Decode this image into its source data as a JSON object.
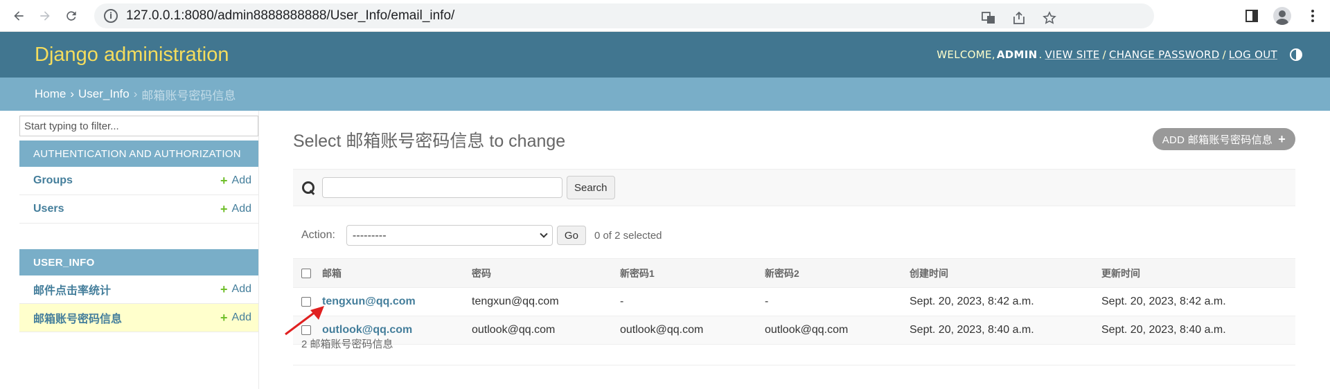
{
  "browser": {
    "url": "127.0.0.1:8080/admin8888888888/User_Info/email_info/"
  },
  "header": {
    "branding": "Django administration",
    "welcome": "WELCOME,",
    "user": "ADMIN",
    "view_site": "VIEW SITE",
    "change_password": "CHANGE PASSWORD",
    "log_out": "LOG OUT"
  },
  "breadcrumbs": {
    "home": "Home",
    "app": "User_Info",
    "current": "邮箱账号密码信息"
  },
  "sidebar": {
    "filter_placeholder": "Start typing to filter...",
    "modules": [
      {
        "caption": "AUTHENTICATION AND AUTHORIZATION",
        "models": [
          {
            "name": "Groups",
            "add": "Add"
          },
          {
            "name": "Users",
            "add": "Add"
          }
        ]
      },
      {
        "caption": "USER_INFO",
        "models": [
          {
            "name": "邮件点击率统计",
            "add": "Add"
          },
          {
            "name": "邮箱账号密码信息",
            "add": "Add"
          }
        ]
      }
    ]
  },
  "main": {
    "title": "Select 邮箱账号密码信息 to change",
    "add_button": "ADD 邮箱账号密码信息",
    "search_button": "Search",
    "action_label": "Action:",
    "action_value": "---------",
    "go_button": "Go",
    "selected_count": "0 of 2 selected",
    "columns": [
      "邮箱",
      "密码",
      "新密码1",
      "新密码2",
      "创建时间",
      "更新时间"
    ],
    "rows": [
      [
        "tengxun@qq.com",
        "tengxun@qq.com",
        "-",
        "-",
        "Sept. 20, 2023, 8:42 a.m.",
        "Sept. 20, 2023, 8:42 a.m."
      ],
      [
        "outlook@qq.com",
        "outlook@qq.com",
        "outlook@qq.com",
        "outlook@qq.com",
        "Sept. 20, 2023, 8:40 a.m.",
        "Sept. 20, 2023, 8:40 a.m."
      ]
    ],
    "result_count": "2 邮箱账号密码信息"
  },
  "colors": {
    "header_bg": "#417690",
    "breadcrumb_bg": "#79aec8",
    "branding": "#f5dd5d",
    "link": "#447e9b",
    "current_row": "#ffffcc",
    "add_plus": "#70bf2b",
    "annotation_arrow": "#e02020"
  }
}
